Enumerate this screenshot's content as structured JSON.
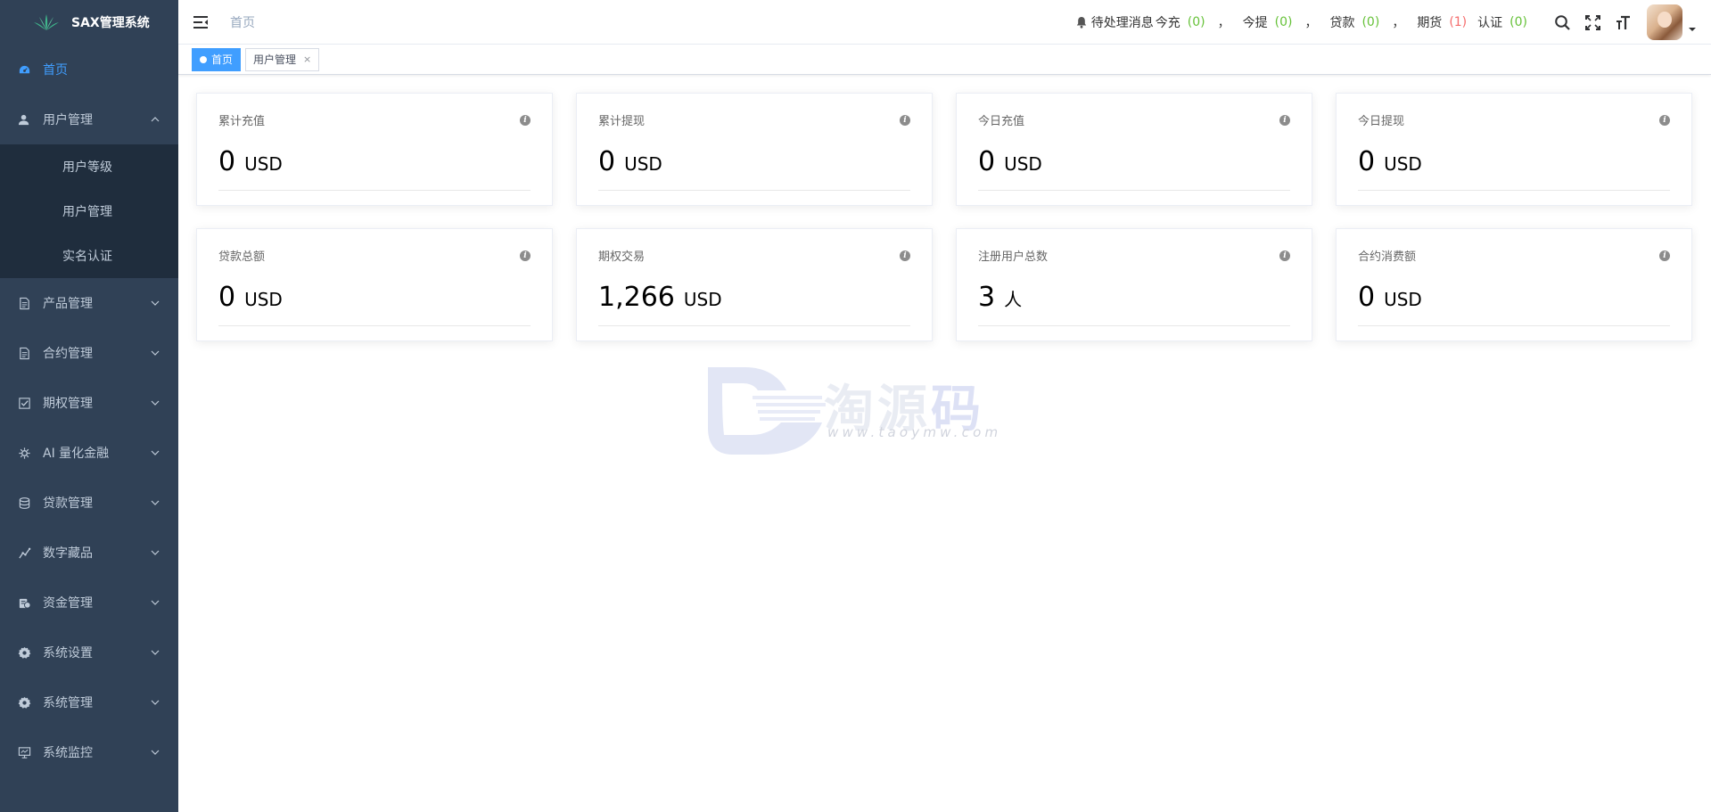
{
  "app": {
    "title": "SAX管理系统"
  },
  "sidebar": {
    "items": [
      {
        "label": "首页",
        "icon": "dashboard-icon",
        "active": true
      },
      {
        "label": "用户管理",
        "icon": "user-icon",
        "expanded": true,
        "children": [
          {
            "label": "用户等级"
          },
          {
            "label": "用户管理"
          },
          {
            "label": "实名认证"
          }
        ]
      },
      {
        "label": "产品管理",
        "icon": "document-icon"
      },
      {
        "label": "合约管理",
        "icon": "document-icon"
      },
      {
        "label": "期权管理",
        "icon": "checkbox-icon"
      },
      {
        "label": "AI 量化金融",
        "icon": "gear-icon"
      },
      {
        "label": "贷款管理",
        "icon": "coins-icon"
      },
      {
        "label": "数字藏品",
        "icon": "chart-line-icon"
      },
      {
        "label": "资金管理",
        "icon": "money-icon"
      },
      {
        "label": "系统设置",
        "icon": "cog-icon"
      },
      {
        "label": "系统管理",
        "icon": "cog-icon"
      },
      {
        "label": "系统监控",
        "icon": "monitor-icon"
      }
    ]
  },
  "header": {
    "breadcrumb": "首页",
    "notice": {
      "label": "待处理消息",
      "items": [
        {
          "label": "今充",
          "count": "(0)",
          "color": "green"
        },
        {
          "label": "今提",
          "count": "(0)",
          "color": "green"
        },
        {
          "label": "贷款",
          "count": "(0)",
          "color": "green"
        },
        {
          "label": "期货",
          "count": "(1)",
          "color": "red"
        },
        {
          "label": "认证",
          "count": "(0)",
          "color": "green"
        }
      ],
      "separator": "，"
    }
  },
  "tags": [
    {
      "label": "首页",
      "active": true
    },
    {
      "label": "用户管理",
      "active": false,
      "close": "×"
    }
  ],
  "cards": [
    {
      "title": "累计充值",
      "value": "0",
      "unit": "USD"
    },
    {
      "title": "累计提现",
      "value": "0",
      "unit": "USD"
    },
    {
      "title": "今日充值",
      "value": "0",
      "unit": "USD"
    },
    {
      "title": "今日提现",
      "value": "0",
      "unit": "USD"
    },
    {
      "title": "贷款总额",
      "value": "0",
      "unit": "USD"
    },
    {
      "title": "期权交易",
      "value": "1,266",
      "unit": "USD"
    },
    {
      "title": "注册用户总数",
      "value": "3",
      "unit": "人"
    },
    {
      "title": "合约消费额",
      "value": "0",
      "unit": "USD"
    }
  ],
  "watermark": {
    "text_a": "淘源",
    "text_b": "码",
    "url": "www.taoymw.com"
  },
  "colors": {
    "sidebar": "#304156",
    "submenu": "#1f2d3d",
    "accent": "#409eff",
    "green": "#67c23a",
    "red": "#f56c6c"
  }
}
